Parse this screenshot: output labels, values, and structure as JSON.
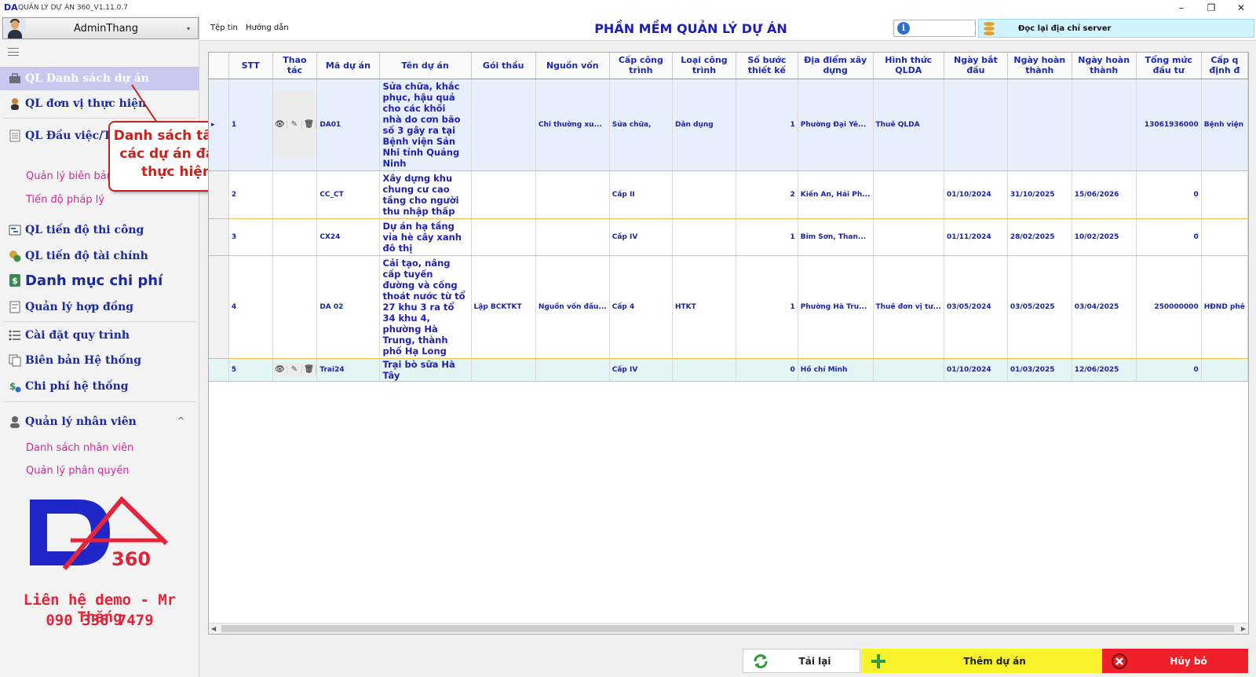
{
  "window": {
    "title": "QUẢN LÝ DỰ ÁN 360_V1.11.0.7",
    "logo_text": "DA",
    "minimize": "–",
    "restore": "❐",
    "close": "✕"
  },
  "user": {
    "name": "AdminThang",
    "caret": "▾"
  },
  "sidebar": {
    "items": [
      {
        "label": "QL Danh sách dự án",
        "icon": "briefcase-icon"
      },
      {
        "label": "QL đơn vị thực hiện",
        "icon": "worker-icon"
      },
      {
        "label": "QL Đầu việc/Ti",
        "icon": "document-icon"
      },
      {
        "label": "QL tiến độ thi công",
        "icon": "schedule-icon"
      },
      {
        "label": "QL tiến độ tài chính",
        "icon": "coins-icon"
      },
      {
        "label": "Danh mục chi phí",
        "icon": "money-icon"
      },
      {
        "label": "Quản lý hợp đồng",
        "icon": "contract-icon"
      },
      {
        "label": "Cài đặt quy trình",
        "icon": "list-icon"
      },
      {
        "label": "Biên bản Hệ thống",
        "icon": "copy-icon"
      },
      {
        "label": "Chi phí hệ thống",
        "icon": "cost-icon"
      },
      {
        "label": "Quản lý nhân viên",
        "icon": "person-icon"
      }
    ],
    "subitems": {
      "work": [
        "Quản lý biên bản",
        "Tiến độ pháp lý"
      ],
      "staff": [
        "Danh sách nhân viên",
        "Quản lý phân quyền"
      ]
    },
    "collapse_glyph": "^"
  },
  "callout": {
    "line1": "Danh sách tất cả",
    "line2": "các dự án đang",
    "line3": "thực hiện"
  },
  "brand": {
    "logo_text": "360",
    "contact_line1": "Liên hệ demo - Mr Thắng",
    "contact_line2": "090 336 7479"
  },
  "topbar": {
    "menu": [
      "Tệp tin",
      "Hướng dẫn"
    ],
    "title": "PHẦN MỀM QUẢN LÝ DỰ ÁN",
    "info_glyph": "i",
    "server_label": "Đọc lại địa chỉ server"
  },
  "table": {
    "columns": [
      "STT",
      "Thao tác",
      "Mã dự án",
      "Tên dự án",
      "Gói thầu",
      "Nguồn vốn",
      "Cấp công trình",
      "Loại công trình",
      "Số bước thiết kế",
      "Địa điểm xây dựng",
      "Hình thức QLDA",
      "Ngày bắt đầu",
      "Ngày hoàn thành",
      "Ngày hoàn thành",
      "Tổng mức đầu tư",
      "Cấp q định đ"
    ],
    "action_icons": [
      "👁",
      "✎",
      "🗑"
    ],
    "rows": [
      {
        "stt": "1",
        "ma": "DA01",
        "ten": "Sửa chữa, khắc phục, hậu quả cho các khối nhà do cơn bão số 3 gây ra tại Bệnh viện Sản Nhi tỉnh Quảng Ninh",
        "goi": "",
        "nguon": "Chi thường xu...",
        "cap": "Sửa chữa,",
        "loai": "Dân dụng",
        "so_buoc": "1",
        "dia_diem": "Phường Đại Yê...",
        "hinh_thuc": "Thuê QLDA",
        "ngay_bd": "",
        "ngay_ht1": "",
        "ngay_ht2": "",
        "tong": "13061936000",
        "cap_qd": "Bệnh viện"
      },
      {
        "stt": "2",
        "ma": "CC_CT",
        "ten": "Xây dựng khu chung cư cao tầng cho người thu nhập thấp",
        "goi": "",
        "nguon": "",
        "cap": "Cấp II",
        "loai": "",
        "so_buoc": "2",
        "dia_diem": "Kiến An, Hải Ph...",
        "hinh_thuc": "",
        "ngay_bd": "01/10/2024",
        "ngay_ht1": "31/10/2025",
        "ngay_ht2": "15/06/2026",
        "tong": "0",
        "cap_qd": ""
      },
      {
        "stt": "3",
        "ma": "CX24",
        "ten": "Dự án hạ tầng vỉa hè cây xanh đô thị",
        "goi": "",
        "nguon": "",
        "cap": "Cấp IV",
        "loai": "",
        "so_buoc": "1",
        "dia_diem": "Bỉm Sơn, Than...",
        "hinh_thuc": "",
        "ngay_bd": "01/11/2024",
        "ngay_ht1": "28/02/2025",
        "ngay_ht2": "10/02/2025",
        "tong": "0",
        "cap_qd": ""
      },
      {
        "stt": "4",
        "ma": "DA 02",
        "ten": "Cải tạo, nâng cấp tuyến đường và cống thoát nước từ tổ 27 khu 3 ra tổ 34 khu 4, phường Hà Trung, thành phố Hạ Long",
        "goi": "Lập BCKTKT",
        "nguon": "Nguồn vốn đầu...",
        "cap": "Cấp 4",
        "loai": "HTKT",
        "so_buoc": "1",
        "dia_diem": "Phường Hà Tru...",
        "hinh_thuc": "Thuê đơn vị tư...",
        "ngay_bd": "03/05/2024",
        "ngay_ht1": "03/05/2025",
        "ngay_ht2": "03/04/2025",
        "tong": "250000000",
        "cap_qd": "HĐND phê"
      },
      {
        "stt": "5",
        "ma": "Trai24",
        "ten": "Trại bò sữa Hà Tây",
        "goi": "",
        "nguon": "",
        "cap": "Cấp IV",
        "loai": "",
        "so_buoc": "0",
        "dia_diem": "Hồ chí Minh",
        "hinh_thuc": "",
        "ngay_bd": "01/10/2024",
        "ngay_ht1": "01/03/2025",
        "ngay_ht2": "12/06/2025",
        "tong": "0",
        "cap_qd": ""
      }
    ]
  },
  "buttons": {
    "reload": "Tải lại",
    "add": "Thêm dự án",
    "cancel": "Hủy bỏ"
  },
  "colors": {
    "title_blue": "#1d1db8",
    "nav_blue": "#1c2a9b",
    "sub_pink": "#d6289c",
    "add_yellow": "#f8f32b",
    "cancel_red": "#f0202b",
    "callout_red": "#c0261f"
  }
}
